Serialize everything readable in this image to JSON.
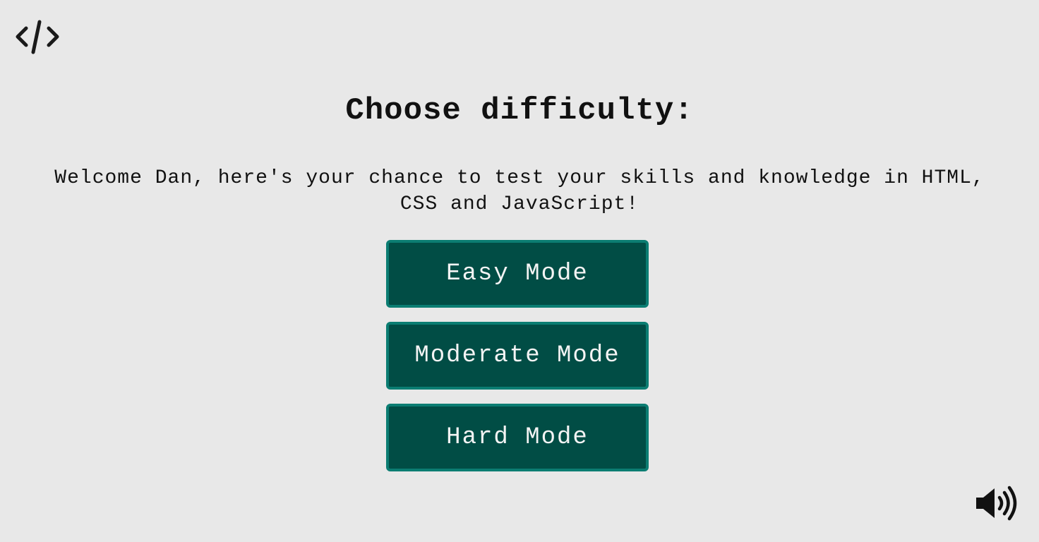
{
  "header": {
    "logo_icon": "code-icon"
  },
  "main": {
    "title": "Choose difficulty:",
    "intro": "Welcome Dan, here's your chance to test your skills and knowledge in HTML, CSS and JavaScript!",
    "modes": [
      {
        "label": "Easy Mode"
      },
      {
        "label": "Moderate Mode"
      },
      {
        "label": "Hard Mode"
      }
    ]
  },
  "footer": {
    "sound_icon": "volume-up-icon"
  },
  "colors": {
    "background": "#e8e8e8",
    "button_fill": "#014d45",
    "button_border": "#0b7d72",
    "button_text": "#f4f4f4"
  }
}
